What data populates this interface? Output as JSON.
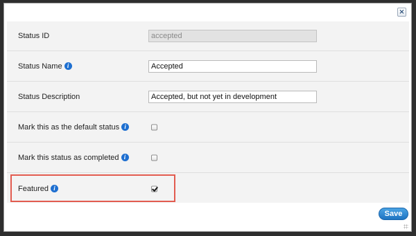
{
  "dialog": {
    "close_label": "×",
    "save_label": "Save"
  },
  "fields": {
    "status_id": {
      "label": "Status ID",
      "value": "accepted"
    },
    "status_name": {
      "label": "Status Name",
      "value": "Accepted"
    },
    "status_description": {
      "label": "Status Description",
      "value": "Accepted, but not yet in development"
    },
    "default_status": {
      "label": "Mark this as the default status",
      "checked": false
    },
    "completed": {
      "label": "Mark this status as completed",
      "checked": false
    },
    "featured": {
      "label": "Featured",
      "checked": true
    }
  },
  "icons": {
    "info_glyph": "i",
    "info_color": "#1e6fd0",
    "highlight_color": "#e25b4f",
    "accent_color": "#1e74c2"
  }
}
